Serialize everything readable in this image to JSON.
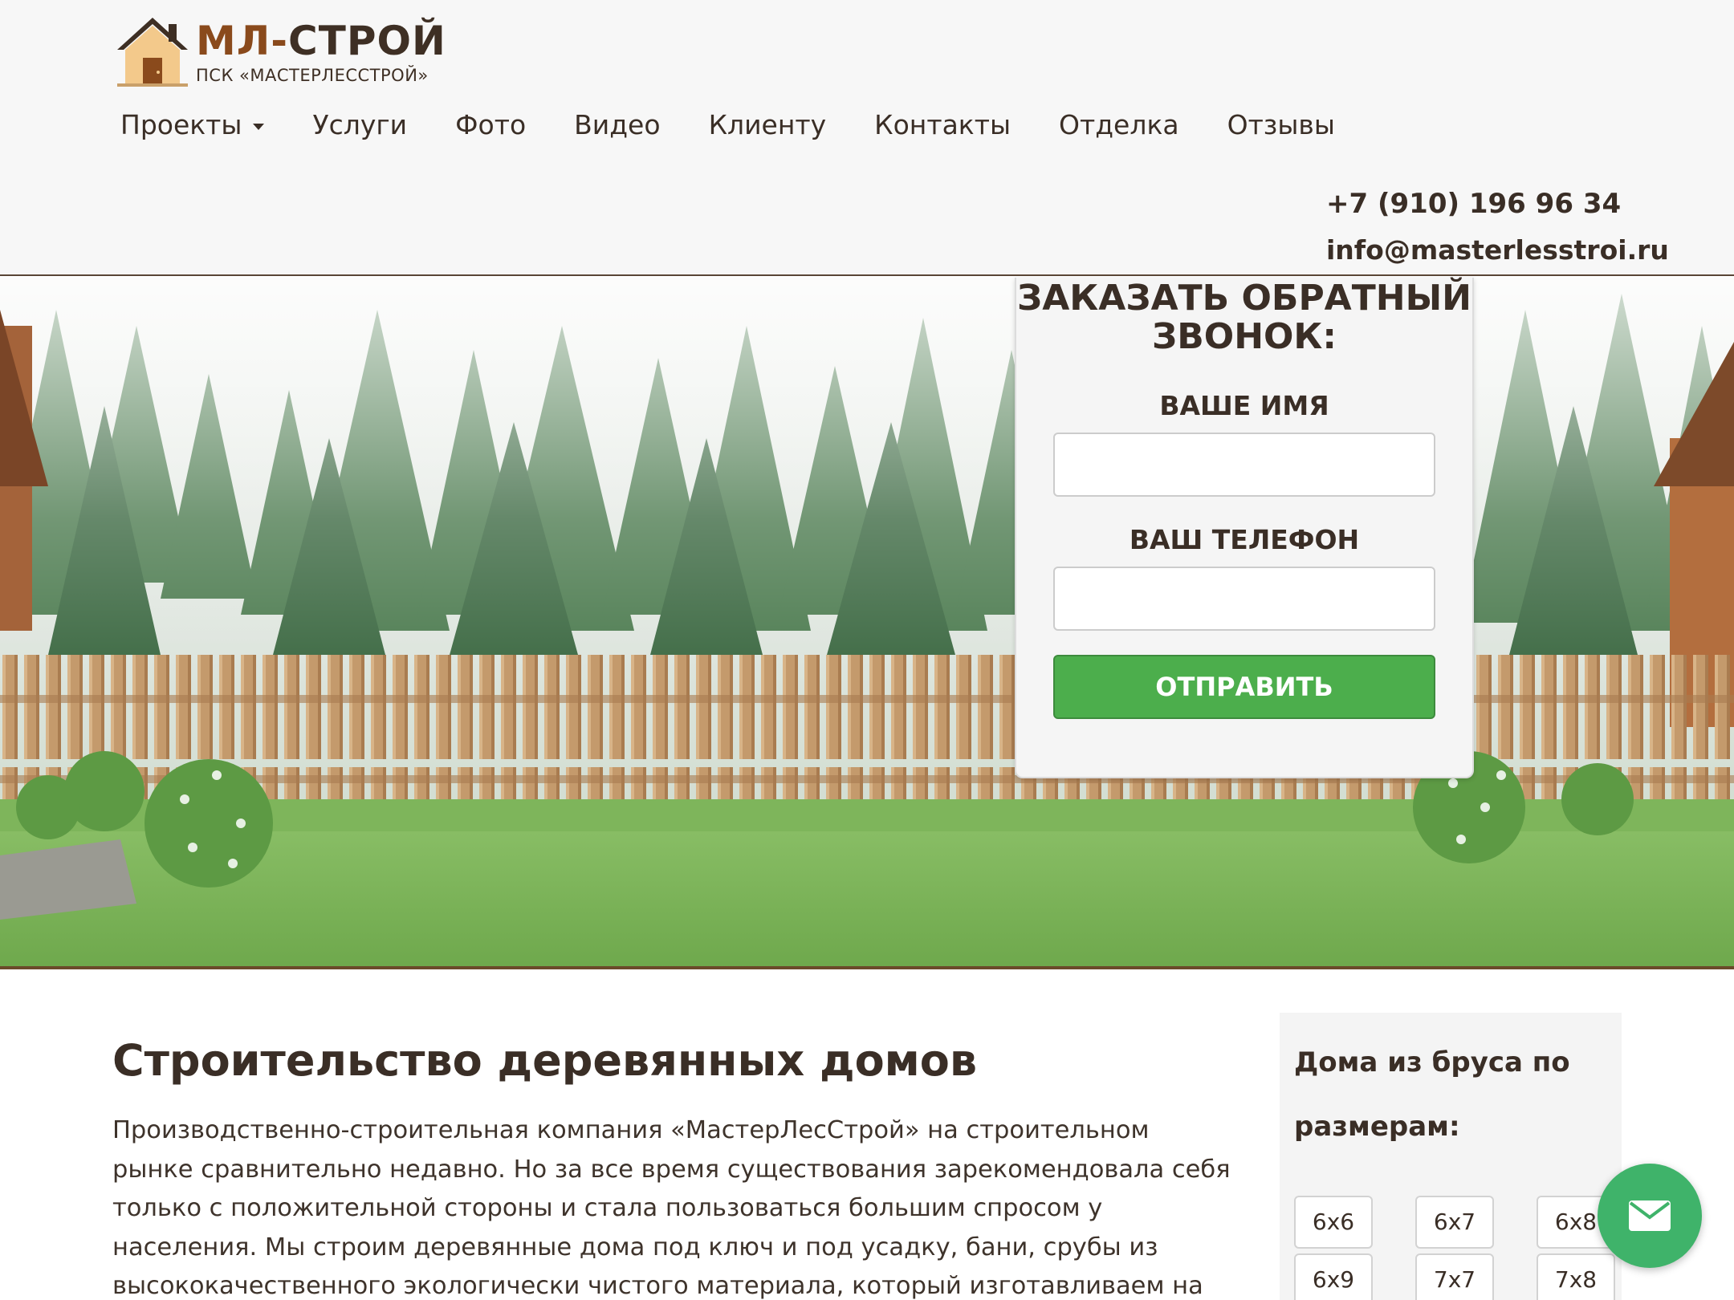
{
  "logo": {
    "title_ml": "МЛ-",
    "title_rest": "СТРОЙ",
    "subtitle": "ПСК «МАСТЕРЛЕССТРОЙ»"
  },
  "nav": {
    "items": [
      {
        "label": "Проекты",
        "has_dropdown": true
      },
      {
        "label": "Услуги"
      },
      {
        "label": "Фото"
      },
      {
        "label": "Видео"
      },
      {
        "label": "Клиенту"
      },
      {
        "label": "Контакты"
      },
      {
        "label": "Отделка"
      },
      {
        "label": "Отзывы"
      }
    ]
  },
  "contacts": {
    "phone": "+7 (910) 196 96 34",
    "email": "info@masterlesstroi.ru"
  },
  "callback_form": {
    "title": "ЗАКАЗАТЬ ОБРАТНЫЙ ЗВОНОК:",
    "name_label": "ВАШЕ ИМЯ",
    "name_value": "",
    "phone_label": "ВАШ ТЕЛЕФОН",
    "phone_value": "",
    "submit_label": "ОТПРАВИТЬ"
  },
  "main": {
    "title": "Строительство деревянных домов",
    "intro": "Производственно-строительная компания «МастерЛесСтрой» на строительном рынке сравнительно недавно. Но за все время существования зарекомендовала себя только с положительной стороны и стала пользоваться большим спросом у населения. Мы строим деревянные дома под ключ и под усадку, бани, срубы из высококачественного экологически чистого материала, который изготавливаем на собственных лесозаготовительных и"
  },
  "sidebar": {
    "title": "Дома из бруса по размерам:",
    "sizes": [
      "6х6",
      "6х7",
      "6х8",
      "6х9",
      "7х7",
      "7х8"
    ]
  },
  "icons": {
    "chat": "envelope-icon",
    "logo": "house-logo-icon",
    "dropdown": "caret-down-icon"
  },
  "colors": {
    "accent_green": "#4cae4c",
    "chat_green": "#3fb36a",
    "brand_brown": "#8a4a1c",
    "text_dark": "#3a2e26"
  }
}
